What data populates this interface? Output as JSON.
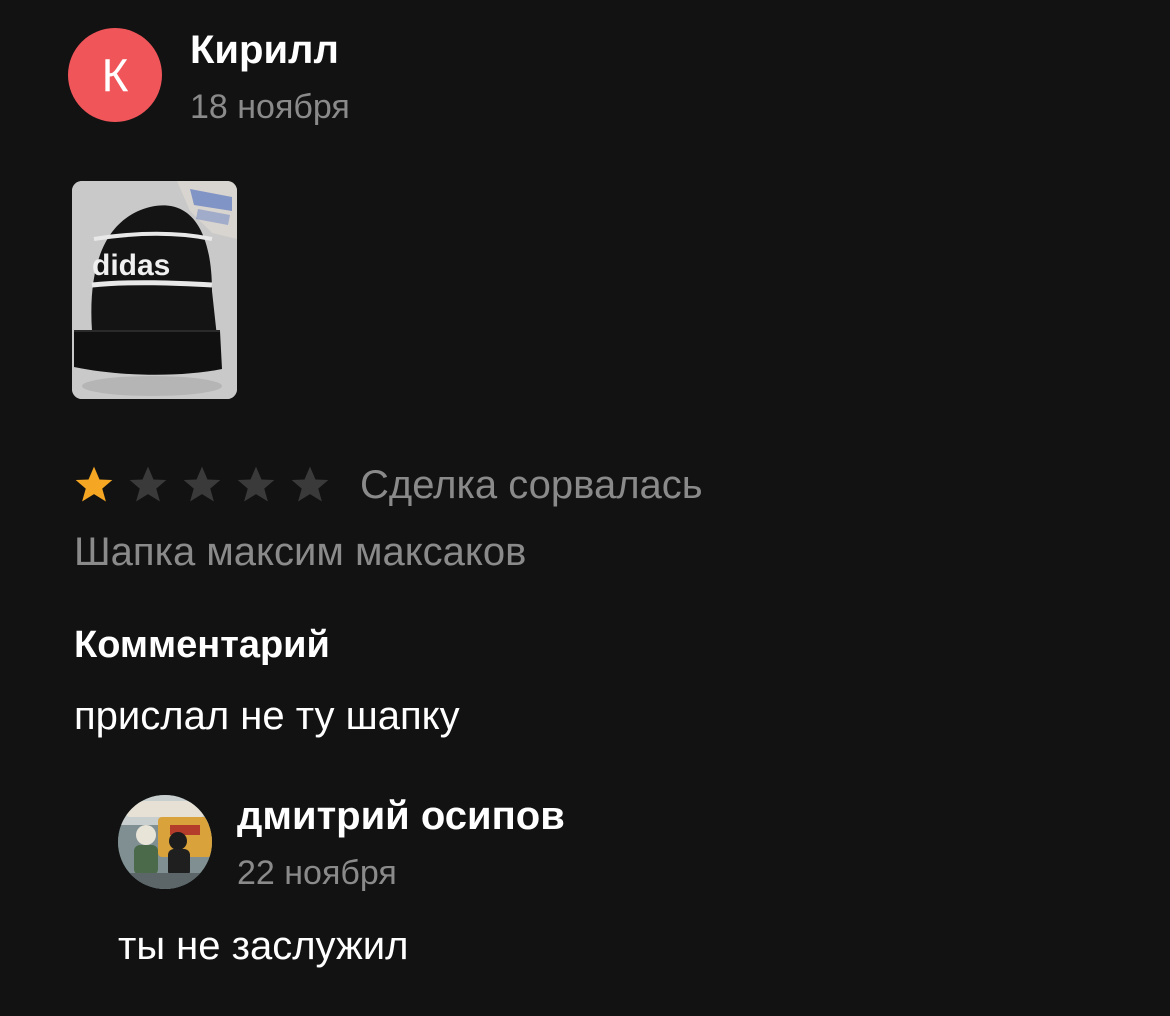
{
  "review": {
    "author": {
      "initial": "К",
      "name": "Кирилл",
      "date": "18 ноября",
      "avatar_color": "#f0555a"
    },
    "photo": {
      "hat_text": "didas"
    },
    "rating": {
      "value": 1,
      "max": 5,
      "filled_color": "#f5a623",
      "empty_color": "#3a3a3a"
    },
    "deal_status": "Сделка сорвалась",
    "item_title": "Шапка максим максаков",
    "comment_heading": "Комментарий",
    "comment_text": "прислал не ту шапку"
  },
  "reply": {
    "name": "дмитрий осипов",
    "date": "22 ноября",
    "text": "ты не заслужил"
  }
}
